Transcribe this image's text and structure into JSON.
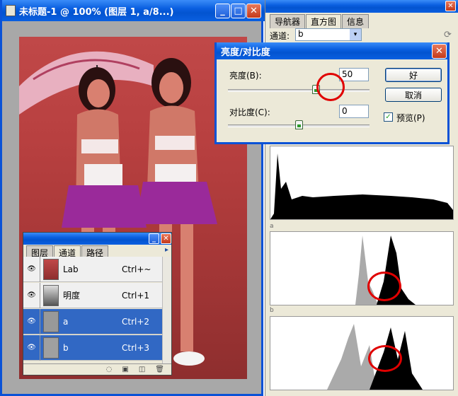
{
  "document": {
    "title": "未标题-1 @ 100% (图层 1, a/8...)",
    "min_label": "_",
    "max_label": "□",
    "close_label": "✕"
  },
  "channels_panel": {
    "tabs": [
      "图层",
      "通道",
      "路径"
    ],
    "active_tab": 1,
    "menu_arrow": "▸",
    "rows": [
      {
        "name": "Lab",
        "shortcut": "Ctrl+~",
        "selected": false
      },
      {
        "name": "明度",
        "shortcut": "Ctrl+1",
        "selected": false
      },
      {
        "name": "a",
        "shortcut": "Ctrl+2",
        "selected": true
      },
      {
        "name": "b",
        "shortcut": "Ctrl+3",
        "selected": true
      }
    ],
    "bottom_icons": [
      "◌",
      "▣",
      "◫",
      "🗑"
    ]
  },
  "histogram_panel": {
    "tabs": [
      "导航器",
      "直方图",
      "信息"
    ],
    "active_tab": 1,
    "channel_label": "通道:",
    "channel_value": "b",
    "section_labels": [
      "a",
      "b"
    ]
  },
  "bc_dialog": {
    "title": "亮度/对比度",
    "brightness_label": "亮度(B):",
    "brightness_value": "50",
    "contrast_label": "对比度(C):",
    "contrast_value": "0",
    "ok_label": "好",
    "cancel_label": "取消",
    "preview_label": "预览(P)",
    "preview_checked": "✓",
    "brightness_fraction": 0.62,
    "contrast_fraction": 0.5
  },
  "colors": {
    "xp_blue": "#0a52d6",
    "selection": "#3168c4",
    "highlight_circle": "#e00000"
  }
}
